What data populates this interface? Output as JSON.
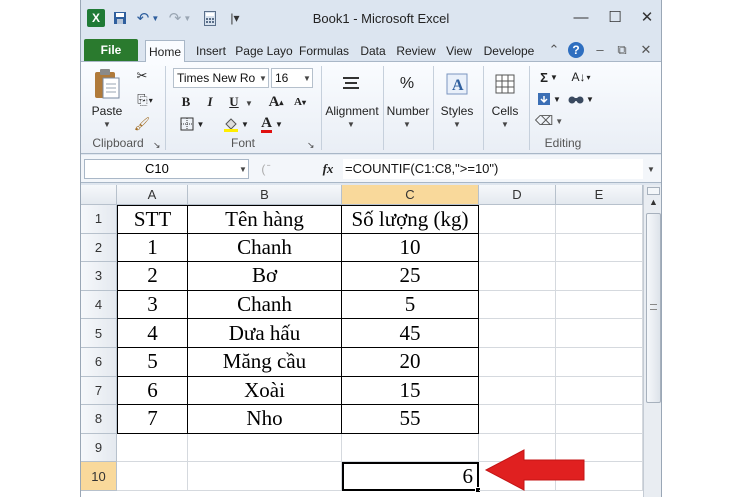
{
  "window": {
    "title": "Book1 - Microsoft Excel",
    "controls": {
      "minimize": "—",
      "maximize": "☐",
      "close": "✕"
    }
  },
  "quick_access": [
    {
      "name": "excel-logo-icon",
      "glyph": "X"
    },
    {
      "name": "save-icon",
      "glyph": "▣"
    },
    {
      "name": "undo-icon",
      "glyph": "↶"
    },
    {
      "name": "redo-icon",
      "glyph": "↷"
    },
    {
      "name": "calculator-icon",
      "glyph": "▦"
    },
    {
      "name": "customize-icon",
      "glyph": "▾"
    }
  ],
  "tabs": [
    "File",
    "Home",
    "Insert",
    "Page Layout",
    "Formulas",
    "Data",
    "Review",
    "View",
    "Developer"
  ],
  "tab_display": [
    "File",
    "Home",
    "Insert",
    "Page Layo",
    "Formulas",
    "Data",
    "Review",
    "View",
    "Develope"
  ],
  "active_tab": "Home",
  "ribbon": {
    "clipboard": {
      "paste": "Paste",
      "label": "Clipboard"
    },
    "font": {
      "name": "Times New Roman",
      "name_display": "Times New Ro",
      "size": "16",
      "bold": "B",
      "italic": "I",
      "underline": "U",
      "grow": "A",
      "shrink": "A",
      "label": "Font"
    },
    "alignment": {
      "label": "Alignment"
    },
    "number": {
      "label": "Number",
      "symbol": "%"
    },
    "styles": {
      "label": "Styles"
    },
    "cells": {
      "label": "Cells"
    },
    "editing": {
      "label": "Editing",
      "sum": "Σ"
    }
  },
  "formula_bar": {
    "name_box": "C10",
    "fx": "fx",
    "formula": "=COUNTIF(C1:C8,\">=10\")"
  },
  "sheet": {
    "columns": [
      "A",
      "B",
      "C",
      "D",
      "E"
    ],
    "selected_column": "C",
    "rows": [
      "1",
      "2",
      "3",
      "4",
      "5",
      "6",
      "7",
      "8",
      "9",
      "10"
    ],
    "selected_row": "10",
    "data": [
      [
        "STT",
        "Tên hàng",
        "Số lượng (kg)"
      ],
      [
        "1",
        "Chanh",
        "10"
      ],
      [
        "2",
        "Bơ",
        "25"
      ],
      [
        "3",
        "Chanh",
        "5"
      ],
      [
        "4",
        "Dưa hấu",
        "45"
      ],
      [
        "5",
        "Măng cầu",
        "20"
      ],
      [
        "6",
        "Xoài",
        "15"
      ],
      [
        "7",
        "Nho",
        "55"
      ]
    ],
    "active_cell": "C10",
    "result": "6"
  },
  "annotation": {
    "arrow_color": "#e02020"
  },
  "colors": {
    "file_tab": "#2a7a2e",
    "selected_header": "#f9d99b"
  }
}
